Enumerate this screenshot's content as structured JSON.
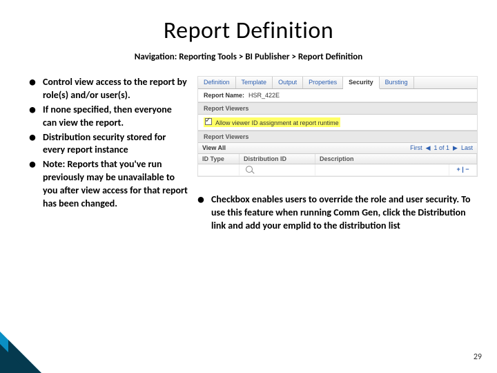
{
  "title": "Report Definition",
  "navigation": "Navigation: Reporting Tools > BI Publisher > Report Definition",
  "left_bullets": [
    "Control view access to the report by role(s) and/or user(s).",
    " If none specified, then everyone can view the report.",
    "Distribution security stored for every report instance",
    "Note: Reports that you've run previously may be unavailable to you after view access for that report has been changed."
  ],
  "right_bullets": [
    "Checkbox enables users to override the role and user security.  To use this feature when running Comm Gen, click the Distribution link and add your emplid to the distribution  list"
  ],
  "screenshot": {
    "tabs": [
      "Definition",
      "Template",
      "Output",
      "Properties",
      "Security",
      "Bursting"
    ],
    "active_tab": "Security",
    "report_name_label": "Report Name:",
    "report_name_value": "HSR_422E",
    "section1": "Report Viewers",
    "checkbox_label": "Allow viewer ID assignment at report runtime",
    "checkbox_checked": true,
    "section2": "Report Viewers",
    "nav_strip": {
      "view_all": "View All",
      "first": "First",
      "range": "1 of 1",
      "last": "Last"
    },
    "table": {
      "headers": [
        "ID Type",
        "Distribution ID",
        "Description"
      ],
      "row": [
        "",
        "",
        ""
      ]
    },
    "plus_minus": "+ | −"
  },
  "page_number": "29"
}
